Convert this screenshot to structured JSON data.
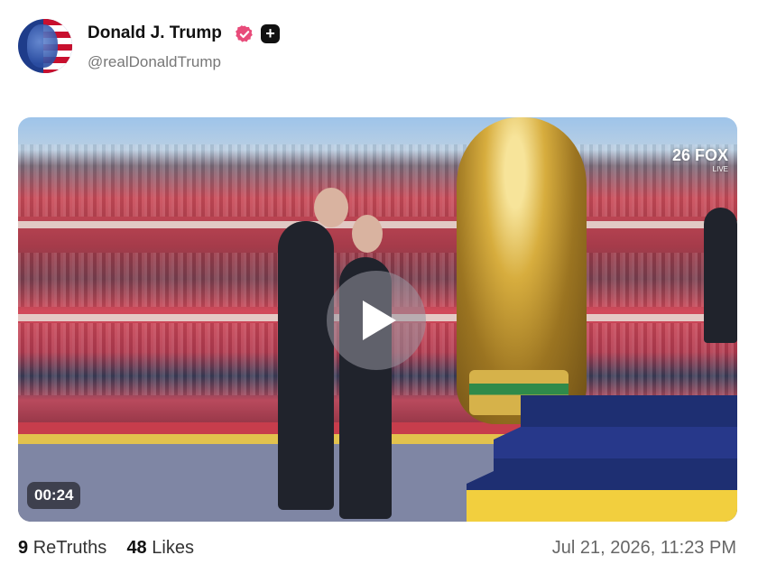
{
  "post": {
    "author_name": "Donald J. Trump",
    "handle": "@realDonaldTrump",
    "verified_icon": "verified-badge-icon",
    "plus_icon": "plus-icon",
    "plus_symbol": "+",
    "video": {
      "duration": "00:24",
      "overlay_logo": "FOX",
      "overlay_logo_sub": "LIVE",
      "overlay_logo_prefix": "26",
      "play_icon": "play-icon"
    },
    "stats": {
      "retruths_count": "9",
      "retruths_label": "ReTruths",
      "likes_count": "48",
      "likes_label": "Likes"
    },
    "timestamp": "Jul 21, 2026, 11:23 PM"
  },
  "colors": {
    "verified_pink": "#e84b7a",
    "badge_black": "#111111",
    "handle_gray": "#777777"
  }
}
